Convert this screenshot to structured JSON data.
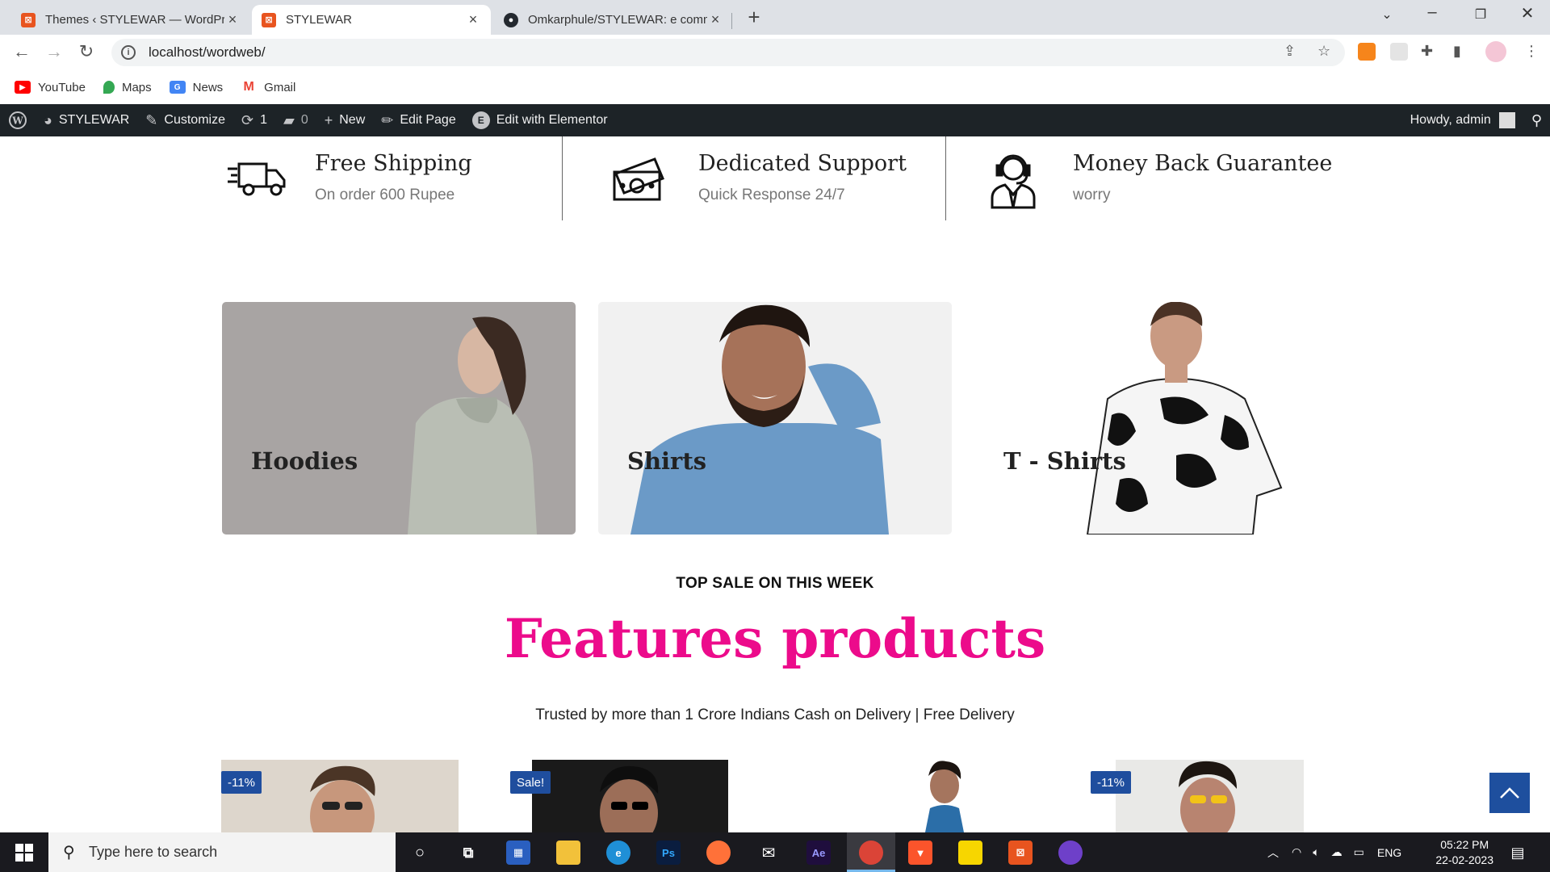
{
  "browser": {
    "tabs": [
      {
        "title": "Themes ‹ STYLEWAR — WordPre",
        "active": false
      },
      {
        "title": "STYLEWAR",
        "active": true
      },
      {
        "title": "Omkarphule/STYLEWAR: e comm",
        "active": false
      }
    ],
    "url": "localhost/wordweb/",
    "bookmarks": [
      "YouTube",
      "Maps",
      "News",
      "Gmail"
    ]
  },
  "adminbar": {
    "site": "STYLEWAR",
    "customize": "Customize",
    "updates": "1",
    "comments": "0",
    "new": "New",
    "edit_page": "Edit Page",
    "elementor": "Edit with Elementor",
    "howdy": "Howdy, admin"
  },
  "features": [
    {
      "title": "Free Shipping",
      "subtitle": "On order 600 Rupee",
      "icon": "truck-icon"
    },
    {
      "title": "Dedicated Support",
      "subtitle": "Quick Response 24/7",
      "icon": "cash-icon"
    },
    {
      "title": "Money Back Guarantee",
      "subtitle": "worry",
      "icon": "support-agent-icon"
    }
  ],
  "categories": [
    {
      "label": "Hoodies"
    },
    {
      "label": "Shirts"
    },
    {
      "label": "T - Shirts"
    }
  ],
  "section": {
    "kicker": "TOP SALE ON THIS WEEK",
    "title": "Features products",
    "trust": "Trusted by more than 1 Crore Indians Cash on Delivery | Free Delivery"
  },
  "products": {
    "badges": [
      "-11%",
      "Sale!",
      "-11%"
    ]
  },
  "taskbar": {
    "search_placeholder": "Type here to search",
    "lang": "ENG",
    "time": "05:22 PM",
    "date": "22-02-2023"
  },
  "colors": {
    "accent_pink": "#ec0b8b",
    "badge_blue": "#1f4e9e",
    "adminbar": "#1d2327"
  }
}
